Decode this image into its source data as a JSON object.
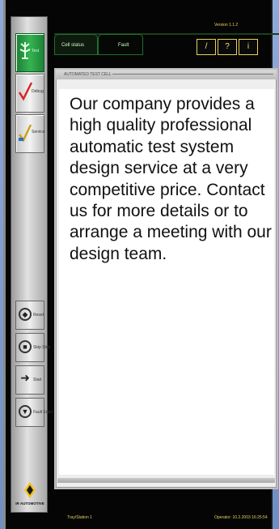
{
  "window": {
    "version": "Version 1.1.2"
  },
  "sidebar": {
    "items": [
      {
        "label": "Test",
        "icon": "tree-icon",
        "active": true
      },
      {
        "label": "Debug",
        "icon": "checkmark-red-icon",
        "active": false
      },
      {
        "label": "Service",
        "icon": "checkmark-yellow-icon",
        "active": false
      }
    ],
    "controls": [
      {
        "label": "Reset",
        "icon": "diamond-icon"
      },
      {
        "label": "Skip Step",
        "icon": "stop-icon"
      },
      {
        "label": "Start",
        "icon": "arrow-right-icon"
      },
      {
        "label": "Fault Enter",
        "icon": "fault-icon"
      }
    ],
    "logo_text": "IR AUTOMOTIVE"
  },
  "tabs": [
    {
      "label": "Cell status",
      "active": true
    },
    {
      "label": "Fault",
      "active": false
    }
  ],
  "toolbar": {
    "buttons": [
      {
        "label": "/",
        "icon": "pencil-icon"
      },
      {
        "label": "?",
        "icon": "help-icon"
      },
      {
        "label": "i",
        "icon": "info-icon"
      }
    ]
  },
  "panel": {
    "title": "AUTOMATED TEST CELL",
    "message": "Our company provides a high quality professional automatic test system design service at a very competitive price. Contact us for more details or to arrange a meeting with our design team."
  },
  "status": {
    "station": "Tray/Station 1",
    "operator": "Operator: 10.2.2003 16:25:54"
  },
  "colors": {
    "accent_green": "#2fae4a",
    "accent_yellow": "#e8d25a",
    "background": "#050505"
  }
}
